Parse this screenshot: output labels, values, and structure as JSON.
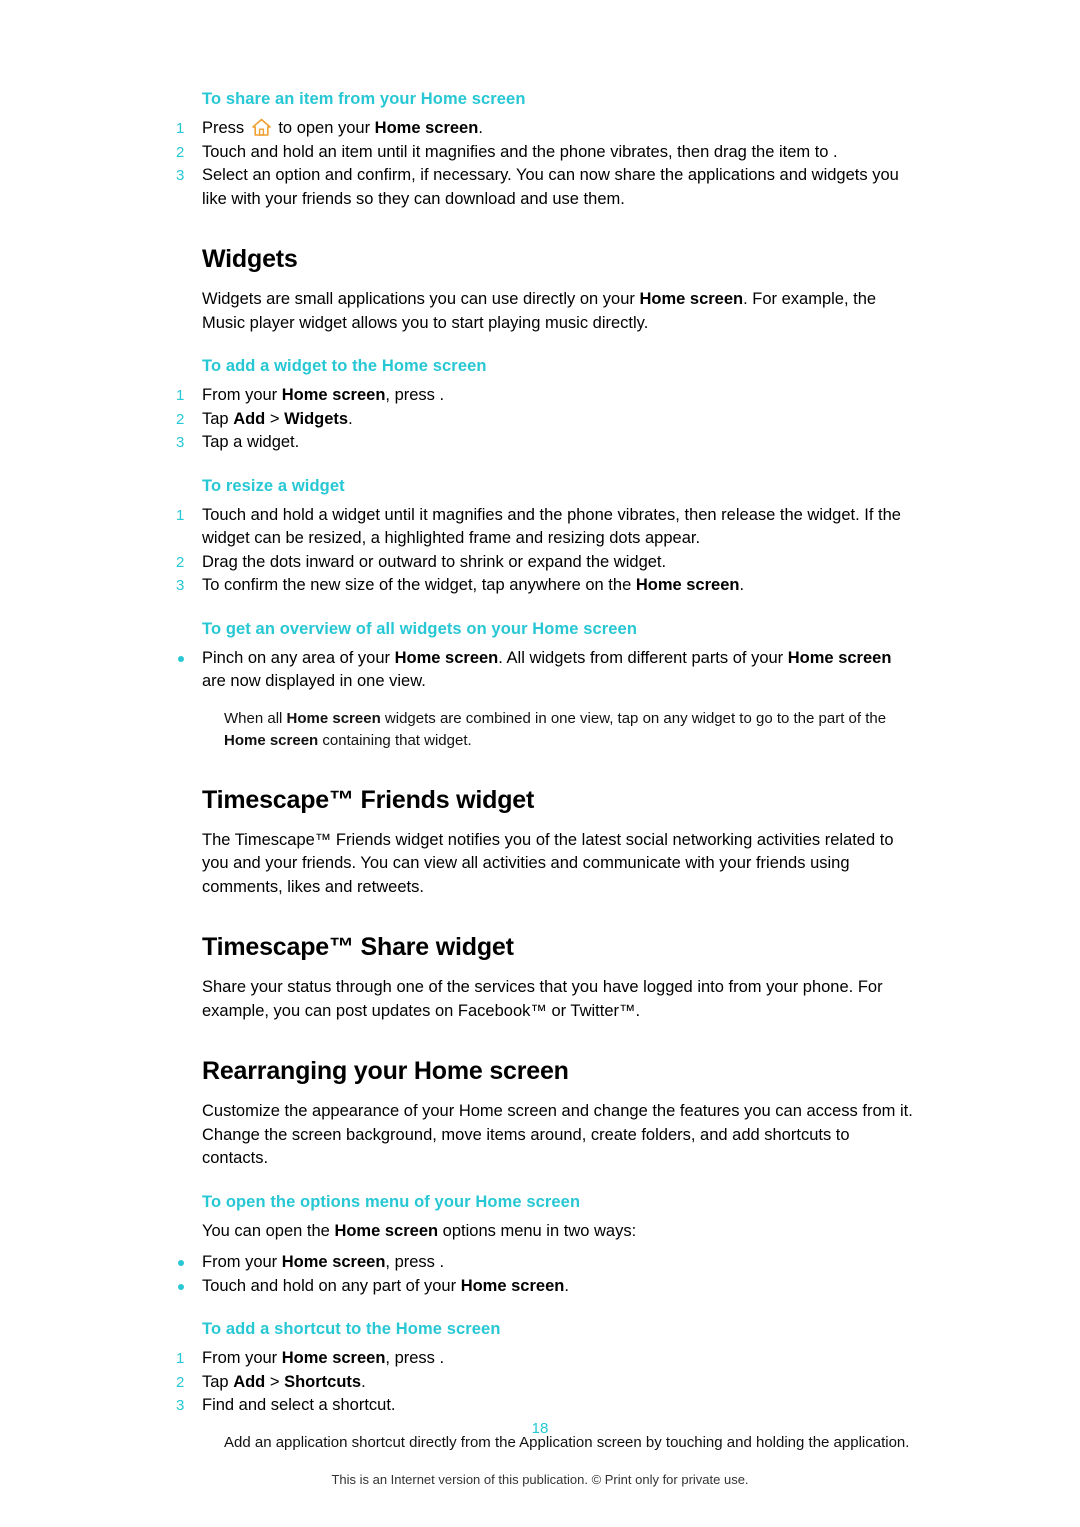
{
  "document": {
    "page_number": "18",
    "footer_note": "This is an Internet version of this publication. © Print only for private use."
  },
  "sections": [
    {
      "task_title": "To share an item from your Home screen",
      "steps": [
        {
          "num": "1",
          "html": "Press [HOME] to open your <b>Home screen</b>."
        },
        {
          "num": "2",
          "html": "Touch and hold an item until it magnifies and the phone vibrates, then drag the item to    ."
        },
        {
          "num": "3",
          "html": "Select an option and confirm, if necessary. You can now share the applications and widgets you like with your friends so they can download and use them."
        }
      ]
    }
  ],
  "widgets": {
    "title": "Widgets",
    "intro": "Widgets are small applications you can use directly on your <b>Home screen</b>. For example, the Music player widget allows you to start playing music directly.",
    "add_widget": {
      "title": "To add a widget to the Home screen",
      "steps": [
        {
          "num": "1",
          "html": "From your <b>Home screen</b>, press    ."
        },
        {
          "num": "2",
          "html": "Tap <b>Add</b> &gt; <b>Widgets</b>."
        },
        {
          "num": "3",
          "html": "Tap a widget."
        }
      ]
    },
    "resize_widget": {
      "title": "To resize a widget",
      "steps": [
        {
          "num": "1",
          "html": "Touch and hold a widget until it magnifies and the phone vibrates, then release the widget. If the widget can be resized, a highlighted frame and resizing dots appear."
        },
        {
          "num": "2",
          "html": "Drag the dots inward or outward to shrink or expand the widget."
        },
        {
          "num": "3",
          "html": "To confirm the new size of the widget, tap anywhere on the <b>Home screen</b>."
        }
      ]
    },
    "overview_widgets": {
      "title": "To get an overview of all widgets on your Home screen",
      "steps": [
        {
          "num": "•",
          "html": "Pinch on any area of your <b>Home screen</b>. All widgets from different parts of your <b>Home screen</b> are now displayed in one view."
        }
      ],
      "note": "When all <b>Home screen</b> widgets are combined in one view, tap on any widget to go to the part of the <b>Home screen</b> containing that widget."
    }
  },
  "timescape_friends": {
    "title": "Timescape™ Friends widget",
    "body": "The Timescape™ Friends widget notifies you of the latest social networking activities related to you and your friends. You can view all activities and communicate with your friends using comments, likes and retweets."
  },
  "timescape_share": {
    "title": "Timescape™ Share widget",
    "body": "Share your status through one of the services that you have logged into from your phone. For example, you can post updates on Facebook™ or Twitter™."
  },
  "rearranging": {
    "title": "Rearranging your Home screen",
    "body": "Customize the appearance of your Home screen and change the features you can access from it. Change the screen background, move items around, create folders, and add shortcuts to contacts.",
    "options_menu": {
      "title": "To open the options menu of your Home screen",
      "lead": "You can open the <b>Home screen</b> options menu in two ways:",
      "steps": [
        {
          "num": "•",
          "html": "From your <b>Home screen</b>, press    ."
        },
        {
          "num": "•",
          "html": "Touch and hold on any part of your <b>Home screen</b>."
        }
      ]
    },
    "add_shortcut": {
      "title": "To add a shortcut to the Home screen",
      "steps": [
        {
          "num": "1",
          "html": "From your <b>Home screen</b>, press    ."
        },
        {
          "num": "2",
          "html": "Tap <b>Add</b> &gt; <b>Shortcuts</b>."
        },
        {
          "num": "3",
          "html": "Find and select a shortcut."
        }
      ],
      "note": "Add an application shortcut directly from the Application screen by touching and holding the application."
    }
  },
  "colors": {
    "accent": "#27c7d4",
    "text": "#000000"
  }
}
